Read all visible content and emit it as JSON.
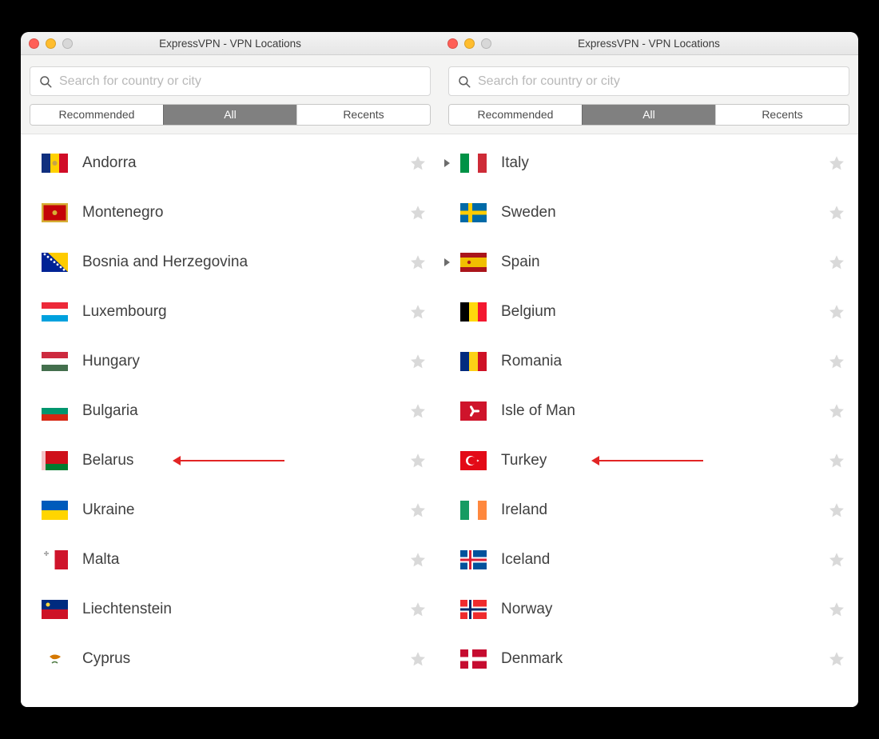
{
  "window_title": "ExpressVPN - VPN Locations",
  "search_placeholder": "Search for country or city",
  "tabs": {
    "recommended": "Recommended",
    "all": "All",
    "recents": "Recents"
  },
  "left_list": [
    {
      "name": "Andorra",
      "flag": "ad"
    },
    {
      "name": "Montenegro",
      "flag": "me"
    },
    {
      "name": "Bosnia and Herzegovina",
      "flag": "ba"
    },
    {
      "name": "Luxembourg",
      "flag": "lu"
    },
    {
      "name": "Hungary",
      "flag": "hu"
    },
    {
      "name": "Bulgaria",
      "flag": "bg"
    },
    {
      "name": "Belarus",
      "flag": "by",
      "annotated": true
    },
    {
      "name": "Ukraine",
      "flag": "ua"
    },
    {
      "name": "Malta",
      "flag": "mt"
    },
    {
      "name": "Liechtenstein",
      "flag": "li"
    },
    {
      "name": "Cyprus",
      "flag": "cy"
    }
  ],
  "right_list": [
    {
      "name": "Italy",
      "flag": "it",
      "expandable": true
    },
    {
      "name": "Sweden",
      "flag": "se"
    },
    {
      "name": "Spain",
      "flag": "es",
      "expandable": true
    },
    {
      "name": "Belgium",
      "flag": "be"
    },
    {
      "name": "Romania",
      "flag": "ro"
    },
    {
      "name": "Isle of Man",
      "flag": "im"
    },
    {
      "name": "Turkey",
      "flag": "tr",
      "annotated": true
    },
    {
      "name": "Ireland",
      "flag": "ie"
    },
    {
      "name": "Iceland",
      "flag": "is"
    },
    {
      "name": "Norway",
      "flag": "no"
    },
    {
      "name": "Denmark",
      "flag": "dk"
    }
  ]
}
